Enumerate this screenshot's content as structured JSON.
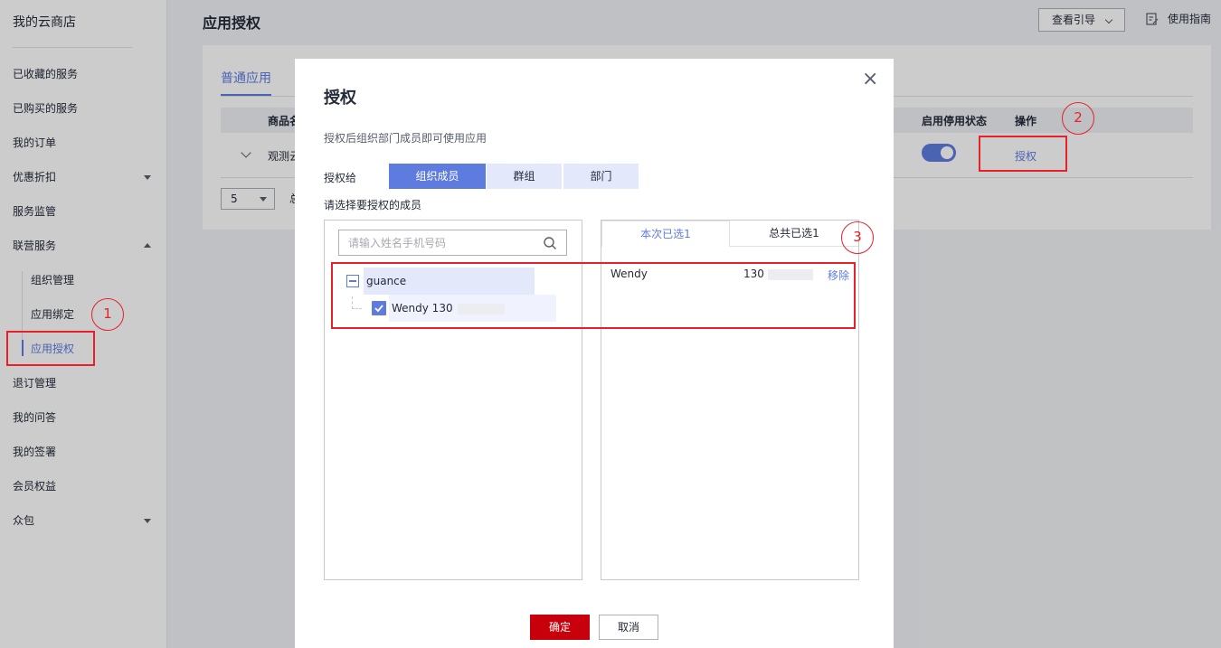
{
  "sidebar": {
    "title": "我的云商店",
    "items": {
      "favorites": "已收藏的服务",
      "purchased": "已购买的服务",
      "orders": "我的订单",
      "discounts": "优惠折扣",
      "monitor": "服务监管",
      "joint": "联营服务",
      "refund": "退订管理",
      "qa": "我的问答",
      "sign": "我的签署",
      "member": "会员权益",
      "crowd": "众包"
    },
    "sub": {
      "org": "组织管理",
      "bind": "应用绑定",
      "auth": "应用授权"
    }
  },
  "header": {
    "title": "应用授权",
    "guide_button": "查看引导",
    "help": "使用指南"
  },
  "main": {
    "tab": "普通应用",
    "columns": {
      "product": "商品名",
      "status": "启用停用状态",
      "action": "操作"
    },
    "row": {
      "name": "观测云",
      "status_enabled": true,
      "action": "授权"
    },
    "page_size": "5",
    "total_label": "总"
  },
  "modal": {
    "title": "授权",
    "close": "×",
    "description": "授权后组织部门成员即可使用应用",
    "authorize_to_label": "授权给",
    "segments": {
      "members": "组织成员",
      "groups": "群组",
      "departments": "部门"
    },
    "active_segment": "组织成员",
    "select_label": "请选择要授权的成员",
    "search_placeholder": "请输入姓名手机号码",
    "tree": {
      "parent": "guance",
      "child": "Wendy 130"
    },
    "right_tabs": {
      "current": "本次已选1",
      "total": "总共已选1"
    },
    "selected": {
      "name": "Wendy",
      "phone": "130",
      "remove": "移除"
    },
    "ok": "确定",
    "cancel": "取消"
  },
  "annotations": {
    "one": "1",
    "two": "2",
    "three": "3"
  },
  "colors": {
    "accent": "#5e7ce0",
    "primary_button": "#c7000b",
    "annotation": "#e8202a"
  }
}
